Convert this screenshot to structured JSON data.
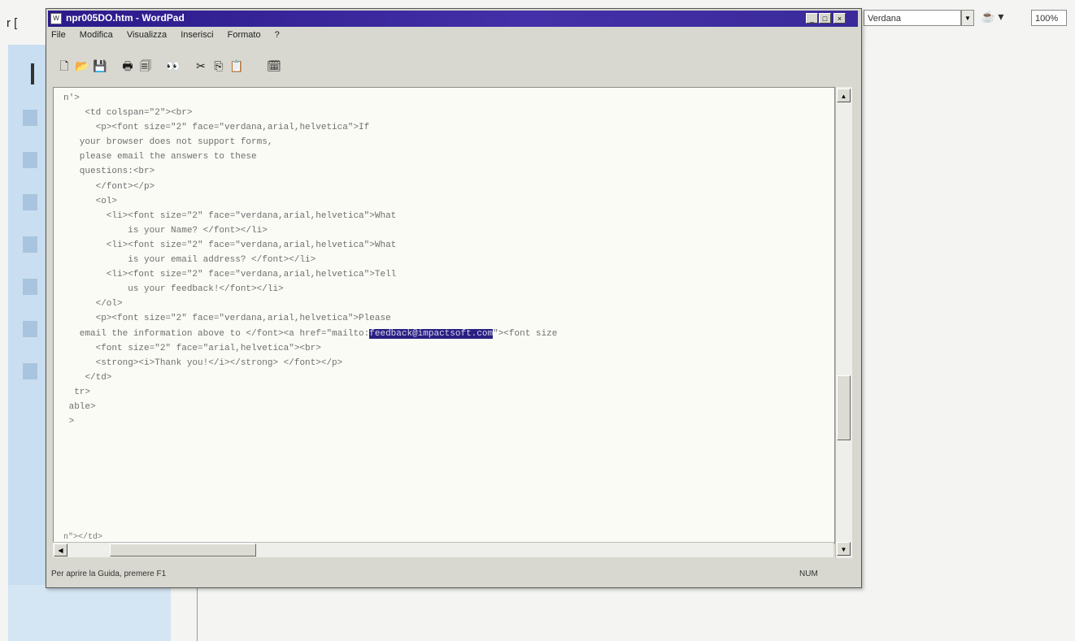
{
  "window": {
    "title": "npr005DO.htm - WordPad",
    "minimize": "_",
    "maximize": "□",
    "close": "×"
  },
  "menu": [
    "File",
    "Modifica",
    "Visualizza",
    "Inserisci",
    "Formato",
    "?"
  ],
  "document": {
    "lines": [
      "n'>",
      "    <td colspan=\"2\"><br>",
      "      <p><font size=\"2\" face=\"verdana,arial,helvetica\">If",
      "   your browser does not support forms,",
      "   please email the answers to these",
      "   questions:<br>",
      "      </font></p>",
      "      <ol>",
      "        <li><font size=\"2\" face=\"verdana,arial,helvetica\">What",
      "            is your Name? </font></li>",
      "        <li><font size=\"2\" face=\"verdana,arial,helvetica\">What",
      "            is your email address? </font></li>",
      "        <li><font size=\"2\" face=\"verdana,arial,helvetica\">Tell",
      "            us your feedback!</font></li>",
      "      </ol>",
      "      <p><font size=\"2\" face=\"verdana,arial,helvetica\">Please"
    ],
    "email_line_before": "   email the information above to </font><a href=\"mailto:",
    "email_selected": "feedback@impactsoft.com",
    "email_line_after": "\"><font size",
    "lines_after": [
      "      <font size=\"2\" face=\"arial,helvetica\"><br>",
      "      <strong><i>Thank you!</i></strong> </font></p>",
      "    </td>",
      "  tr>",
      " able>",
      " >"
    ],
    "bottom_fragment": "n\"></td>"
  },
  "status": {
    "help_text": "Per aprire la Guida, premere F1",
    "indicator": "NUM"
  },
  "background_app": {
    "left_glyphs": "r [",
    "font_field": "Verdana",
    "zoom_field": "100%"
  }
}
